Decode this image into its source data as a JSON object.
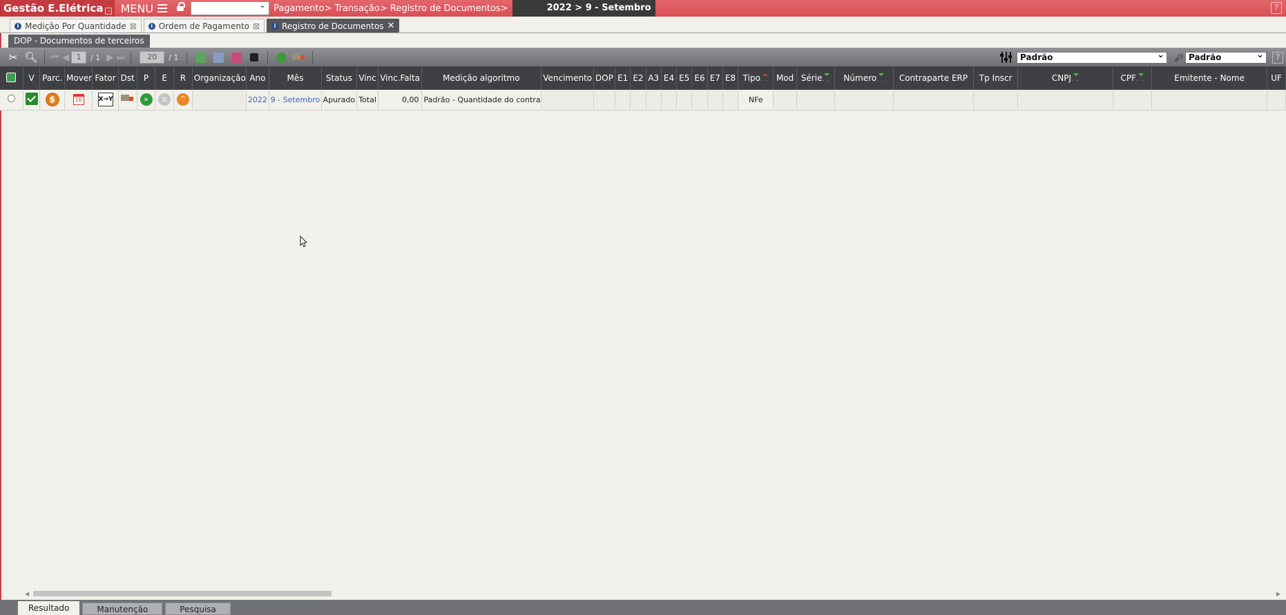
{
  "app": {
    "title": "Gestão E.Elétrica",
    "menu_label": "MENU",
    "breadcrumb": "Pagamento> Transação> Registro de Documentos>",
    "period": "2022 > 9 - Setembro",
    "help": "?"
  },
  "tabs": [
    {
      "label": "Medição Por Quantidade",
      "active": false
    },
    {
      "label": "Ordem de Pagamento",
      "active": false
    },
    {
      "label": "Registro de Documentos",
      "active": true
    }
  ],
  "subtab": {
    "label": "DOP - Documentos de terceiros"
  },
  "toolbar": {
    "page_current": "1",
    "page_total": "/ 1",
    "page_size": "20",
    "size_total": "/ 1",
    "view_select": "Padrão",
    "filter_select": "Padrão",
    "help": "?"
  },
  "grid": {
    "headers": [
      "V",
      "Parc.",
      "Mover",
      "Fator",
      "Dst",
      "P",
      "E",
      "R",
      "Organização",
      "Ano",
      "Mês",
      "Status",
      "Vinc",
      "Vinc.Falta",
      "Medição algoritmo",
      "Vencimento",
      "DOP",
      "E1",
      "E2",
      "A3",
      "E4",
      "E5",
      "E6",
      "E7",
      "E8",
      "Tipo",
      "Mod",
      "Série",
      "Número",
      "Contraparte ERP",
      "Tp Inscr",
      "CNPJ",
      "CPF",
      "Emitente - Nome",
      "UF"
    ],
    "rows": [
      {
        "fator": "X→Y",
        "organizacao": "",
        "ano": "2022",
        "mes": "9 - Setembro",
        "status": "Apurado",
        "vinc": "Total",
        "vinc_falta": "0,00",
        "medicao_algoritmo": "Padrão - Quantidade do contrato",
        "tipo": "NFe",
        "coin": "$",
        "cal": "10",
        "p": "»",
        "e": "×",
        "r": "^"
      }
    ]
  },
  "bottom_tabs": [
    "Resultado",
    "Manutenção",
    "Pesquisa"
  ]
}
